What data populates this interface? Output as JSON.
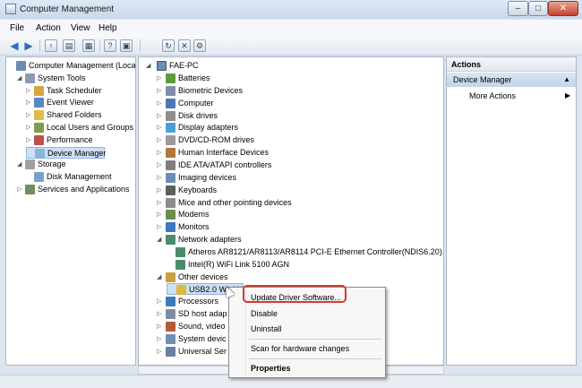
{
  "window": {
    "title": "Computer Management",
    "controls": {
      "minimize": "–",
      "maximize": "□",
      "close": "✕"
    }
  },
  "menu": [
    "File",
    "Action",
    "View",
    "Help"
  ],
  "left_tree": [
    {
      "label": "Computer Management (Local",
      "level": 0,
      "expander": ""
    },
    {
      "label": "System Tools",
      "level": 1,
      "expander": "◢"
    },
    {
      "label": "Task Scheduler",
      "level": 2,
      "expander": "▷"
    },
    {
      "label": "Event Viewer",
      "level": 2,
      "expander": "▷"
    },
    {
      "label": "Shared Folders",
      "level": 2,
      "expander": "▷"
    },
    {
      "label": "Local Users and Groups",
      "level": 2,
      "expander": "▷"
    },
    {
      "label": "Performance",
      "level": 2,
      "expander": "▷"
    },
    {
      "label": "Device Manager",
      "level": 2,
      "expander": "",
      "selected": true
    },
    {
      "label": "Storage",
      "level": 1,
      "expander": "◢"
    },
    {
      "label": "Disk Management",
      "level": 2,
      "expander": ""
    },
    {
      "label": "Services and Applications",
      "level": 1,
      "expander": "▷"
    }
  ],
  "device_tree": {
    "root": "FAE-PC",
    "rows": [
      {
        "label": "Batteries",
        "level": 1,
        "expander": "▷"
      },
      {
        "label": "Biometric Devices",
        "level": 1,
        "expander": "▷"
      },
      {
        "label": "Computer",
        "level": 1,
        "expander": "▷"
      },
      {
        "label": "Disk drives",
        "level": 1,
        "expander": "▷"
      },
      {
        "label": "Display adapters",
        "level": 1,
        "expander": "▷"
      },
      {
        "label": "DVD/CD-ROM drives",
        "level": 1,
        "expander": "▷"
      },
      {
        "label": "Human Interface Devices",
        "level": 1,
        "expander": "▷"
      },
      {
        "label": "IDE ATA/ATAPI controllers",
        "level": 1,
        "expander": "▷"
      },
      {
        "label": "Imaging devices",
        "level": 1,
        "expander": "▷"
      },
      {
        "label": "Keyboards",
        "level": 1,
        "expander": "▷"
      },
      {
        "label": "Mice and other pointing devices",
        "level": 1,
        "expander": "▷"
      },
      {
        "label": "Modems",
        "level": 1,
        "expander": "▷"
      },
      {
        "label": "Monitors",
        "level": 1,
        "expander": "▷"
      },
      {
        "label": "Network adapters",
        "level": 1,
        "expander": "◢"
      },
      {
        "label": "Atheros AR8121/AR8113/AR8114 PCI-E Ethernet Controller(NDIS6.20)",
        "level": 2,
        "expander": ""
      },
      {
        "label": "Intel(R) WiFi Link 5100 AGN",
        "level": 2,
        "expander": ""
      },
      {
        "label": "Other devices",
        "level": 1,
        "expander": "◢"
      },
      {
        "label": "USB2.0 WLAN",
        "level": 2,
        "expander": "",
        "selected": true
      },
      {
        "label": "Processors",
        "level": 1,
        "expander": "▷"
      },
      {
        "label": "SD host adap",
        "level": 1,
        "expander": "▷"
      },
      {
        "label": "Sound, video",
        "level": 1,
        "expander": "▷"
      },
      {
        "label": "System devic",
        "level": 1,
        "expander": "▷"
      },
      {
        "label": "Universal Ser",
        "level": 1,
        "expander": "▷"
      }
    ]
  },
  "actions": {
    "header": "Actions",
    "group": "Device Manager",
    "group_caret": "▲",
    "more": "More Actions",
    "more_arrow": "▶"
  },
  "context_menu": {
    "items": [
      {
        "label": "Update Driver Software...",
        "bold": false
      },
      {
        "label": "Disable",
        "bold": false
      },
      {
        "label": "Uninstall",
        "bold": false
      },
      {
        "label": "Scan for hardware changes",
        "bold": false
      },
      {
        "label": "Properties",
        "bold": true
      }
    ]
  },
  "colors": {
    "highlight": "#d33a2f",
    "selection": "#cde0f5"
  }
}
